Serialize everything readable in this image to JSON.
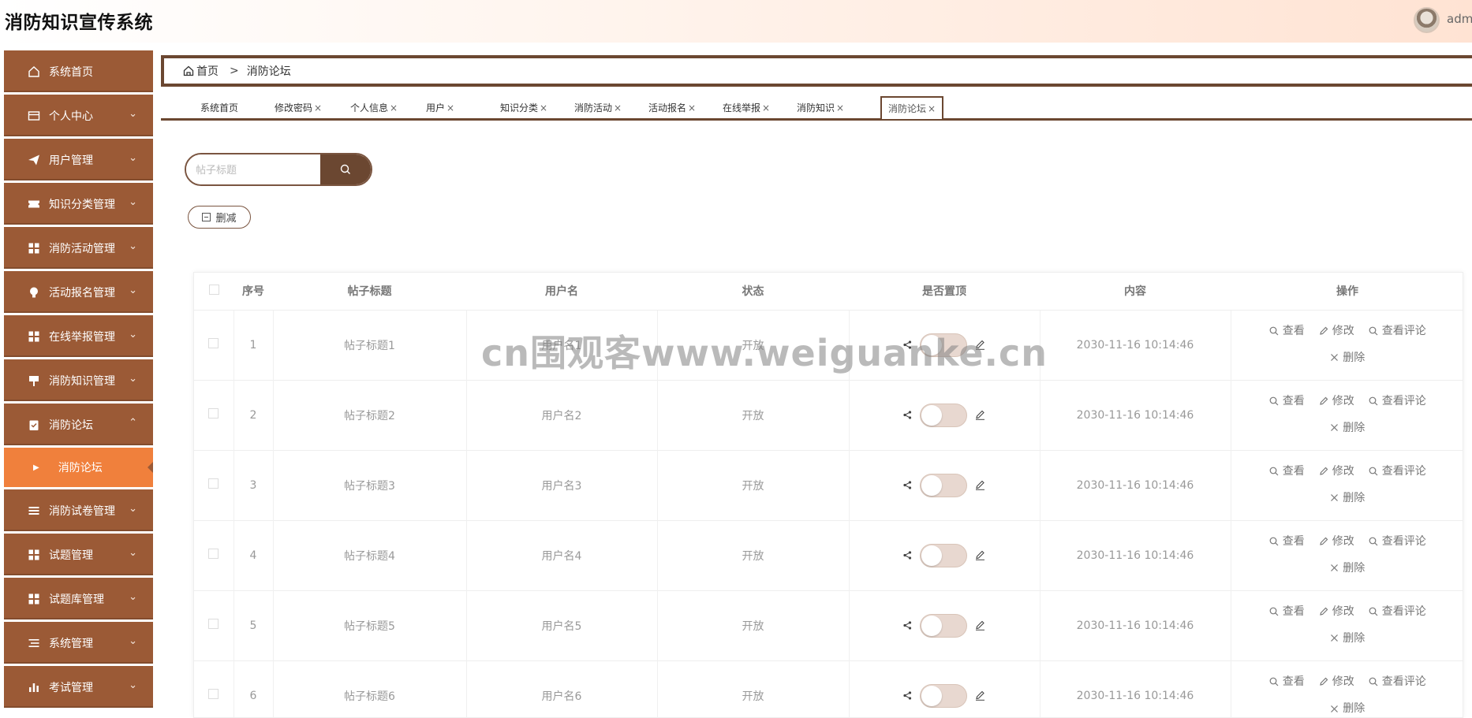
{
  "header": {
    "title": "消防知识宣传系统",
    "username": "adm"
  },
  "sidebar": {
    "items": [
      {
        "label": "系统首页",
        "icon": "home-icon",
        "chevron": ""
      },
      {
        "label": "个人中心",
        "icon": "card-icon",
        "chevron": "⌄"
      },
      {
        "label": "用户管理",
        "icon": "send-icon",
        "chevron": "⌄"
      },
      {
        "label": "知识分类管理",
        "icon": "ticket-icon",
        "chevron": "⌄"
      },
      {
        "label": "消防活动管理",
        "icon": "grid-icon",
        "chevron": "⌄"
      },
      {
        "label": "活动报名管理",
        "icon": "bulb-icon",
        "chevron": "⌄"
      },
      {
        "label": "在线举报管理",
        "icon": "grid-icon",
        "chevron": "⌄"
      },
      {
        "label": "消防知识管理",
        "icon": "sign-icon",
        "chevron": "⌄"
      },
      {
        "label": "消防论坛",
        "icon": "clipboard-icon",
        "chevron": "⌃"
      },
      {
        "label": "消防试卷管理",
        "icon": "list-icon",
        "chevron": "⌄"
      },
      {
        "label": "试题管理",
        "icon": "grid-icon",
        "chevron": "⌄"
      },
      {
        "label": "试题库管理",
        "icon": "grid-icon",
        "chevron": "⌄"
      },
      {
        "label": "系统管理",
        "icon": "menu-icon",
        "chevron": "⌄"
      },
      {
        "label": "考试管理",
        "icon": "bar-chart-icon",
        "chevron": "⌄"
      }
    ],
    "sub_item": {
      "label": "消防论坛"
    }
  },
  "breadcrumb": {
    "home": "首页",
    "separator": ">",
    "current": "消防论坛"
  },
  "tabs": [
    {
      "label": "系统首页",
      "closable": false
    },
    {
      "label": "修改密码",
      "closable": true
    },
    {
      "label": "个人信息",
      "closable": true
    },
    {
      "label": "用户",
      "closable": true
    },
    {
      "label": "知识分类",
      "closable": true
    },
    {
      "label": "消防活动",
      "closable": true
    },
    {
      "label": "活动报名",
      "closable": true
    },
    {
      "label": "在线举报",
      "closable": true
    },
    {
      "label": "消防知识",
      "closable": true
    },
    {
      "label": "消防论坛",
      "closable": true,
      "active": true
    }
  ],
  "search": {
    "placeholder": "帖子标题",
    "value": ""
  },
  "toolbar": {
    "delete_label": "删减"
  },
  "table": {
    "headers": [
      "序号",
      "帖子标题",
      "用户名",
      "状态",
      "是否置顶",
      "内容",
      "操作"
    ],
    "rows": [
      {
        "index": "1",
        "title": "帖子标题1",
        "username": "用户名1",
        "status": "开放",
        "content": "2030-11-16 10:14:46"
      },
      {
        "index": "2",
        "title": "帖子标题2",
        "username": "用户名2",
        "status": "开放",
        "content": "2030-11-16 10:14:46"
      },
      {
        "index": "3",
        "title": "帖子标题3",
        "username": "用户名3",
        "status": "开放",
        "content": "2030-11-16 10:14:46"
      },
      {
        "index": "4",
        "title": "帖子标题4",
        "username": "用户名4",
        "status": "开放",
        "content": "2030-11-16 10:14:46"
      },
      {
        "index": "5",
        "title": "帖子标题5",
        "username": "用户名5",
        "status": "开放",
        "content": "2030-11-16 10:14:46"
      },
      {
        "index": "6",
        "title": "帖子标题6",
        "username": "用户名6",
        "status": "开放",
        "content": "2030-11-16 10:14:46"
      }
    ],
    "actions": {
      "view": "查看",
      "edit": "修改",
      "comments": "查看评论",
      "delete": "删除"
    }
  },
  "watermark": "cn围观客www.weiguanke.cn",
  "colors": {
    "sidebar": "#9b5a36",
    "sidebar_active": "#f0803c",
    "accent": "#6b4731"
  }
}
